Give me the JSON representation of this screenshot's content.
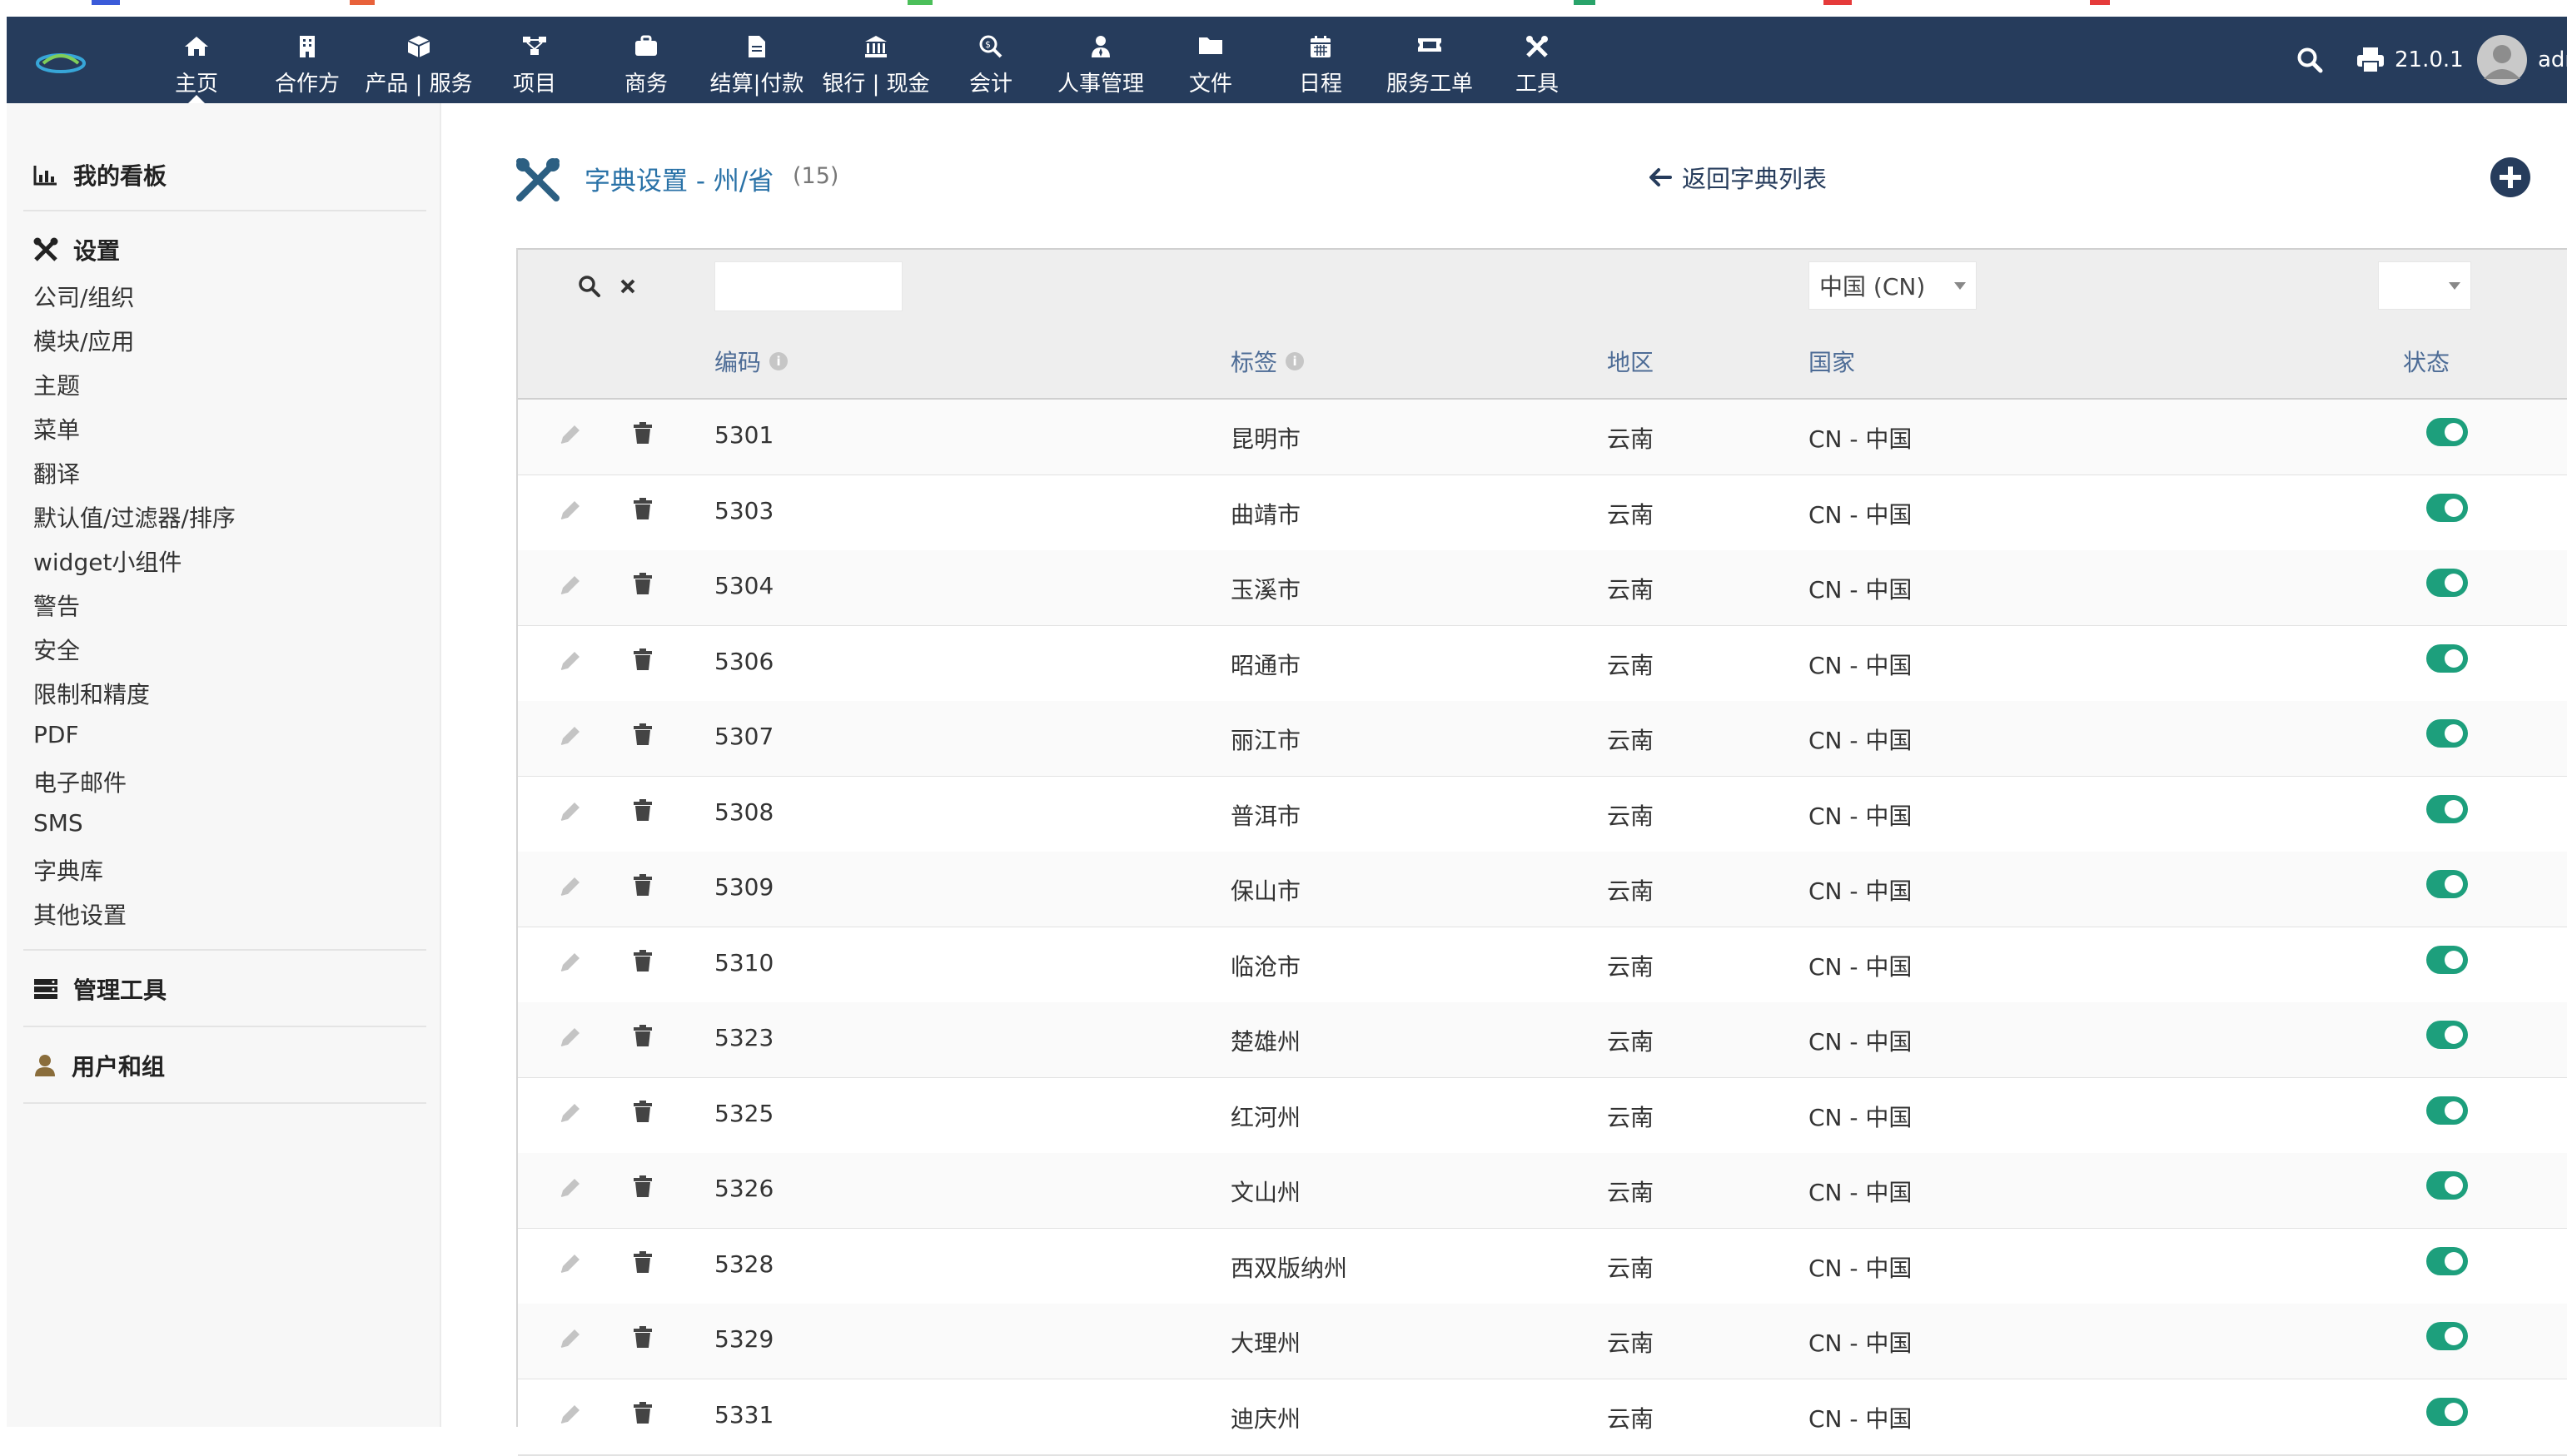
{
  "navbar": {
    "items": [
      {
        "label": "主页",
        "icon": "home-icon"
      },
      {
        "label": "合作方",
        "icon": "building-icon"
      },
      {
        "label": "产品 | 服务",
        "icon": "cube-icon"
      },
      {
        "label": "项目",
        "icon": "project-icon"
      },
      {
        "label": "商务",
        "icon": "briefcase-icon"
      },
      {
        "label": "结算|付款",
        "icon": "invoice-icon"
      },
      {
        "label": "银行 | 现金",
        "icon": "bank-icon"
      },
      {
        "label": "会计",
        "icon": "search-dollar-icon"
      },
      {
        "label": "人事管理",
        "icon": "user-tie-icon"
      },
      {
        "label": "文件",
        "icon": "folder-icon"
      },
      {
        "label": "日程",
        "icon": "calendar-icon"
      },
      {
        "label": "服务工单",
        "icon": "ticket-icon"
      },
      {
        "label": "工具",
        "icon": "tools-icon"
      }
    ],
    "active_index": 0,
    "version": "21.0.1",
    "user": "adm"
  },
  "sidebar": {
    "dashboard_label": "我的看板",
    "settings_label": "设置",
    "settings_items": [
      "公司/组织",
      "模块/应用",
      "主题",
      "菜单",
      "翻译",
      "默认值/过滤器/排序",
      "widget小组件",
      "警告",
      "安全",
      "限制和精度",
      "PDF",
      "电子邮件",
      "SMS",
      "字典库",
      "其他设置"
    ],
    "admin_tools_label": "管理工具",
    "users_groups_label": "用户和组"
  },
  "page": {
    "title": "字典设置 - 州/省",
    "count": "(15)",
    "back_label": "返回字典列表"
  },
  "filters": {
    "code_value": "",
    "country_selected": "中国 (CN)",
    "status_selected": ""
  },
  "table": {
    "headers": {
      "code": "编码",
      "label": "标签",
      "region": "地区",
      "country": "国家",
      "status": "状态"
    },
    "rows": [
      {
        "code": "5301",
        "label": "昆明市",
        "region": "云南",
        "country": "CN - 中国",
        "active": true
      },
      {
        "code": "5303",
        "label": "曲靖市",
        "region": "云南",
        "country": "CN - 中国",
        "active": true
      },
      {
        "code": "5304",
        "label": "玉溪市",
        "region": "云南",
        "country": "CN - 中国",
        "active": true
      },
      {
        "code": "5306",
        "label": "昭通市",
        "region": "云南",
        "country": "CN - 中国",
        "active": true
      },
      {
        "code": "5307",
        "label": "丽江市",
        "region": "云南",
        "country": "CN - 中国",
        "active": true
      },
      {
        "code": "5308",
        "label": "普洱市",
        "region": "云南",
        "country": "CN - 中国",
        "active": true
      },
      {
        "code": "5309",
        "label": "保山市",
        "region": "云南",
        "country": "CN - 中国",
        "active": true
      },
      {
        "code": "5310",
        "label": "临沧市",
        "region": "云南",
        "country": "CN - 中国",
        "active": true
      },
      {
        "code": "5323",
        "label": "楚雄州",
        "region": "云南",
        "country": "CN - 中国",
        "active": true
      },
      {
        "code": "5325",
        "label": "红河州",
        "region": "云南",
        "country": "CN - 中国",
        "active": true
      },
      {
        "code": "5326",
        "label": "文山州",
        "region": "云南",
        "country": "CN - 中国",
        "active": true
      },
      {
        "code": "5328",
        "label": "西双版纳州",
        "region": "云南",
        "country": "CN - 中国",
        "active": true
      },
      {
        "code": "5329",
        "label": "大理州",
        "region": "云南",
        "country": "CN - 中国",
        "active": true
      },
      {
        "code": "5331",
        "label": "迪庆州",
        "region": "云南",
        "country": "CN - 中国",
        "active": true
      }
    ]
  },
  "colors": {
    "navbar_bg": "#263c5c",
    "toggle_on": "#1d9f7c",
    "title_blue": "#2a72a7"
  }
}
